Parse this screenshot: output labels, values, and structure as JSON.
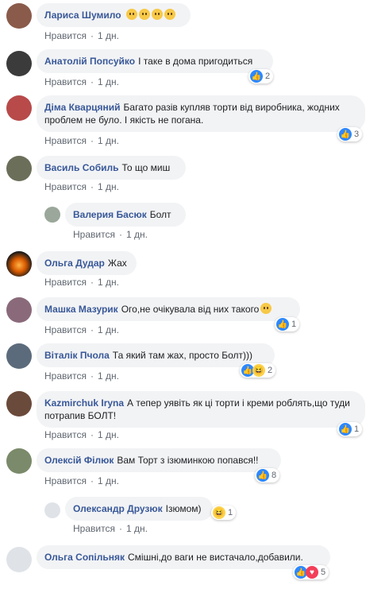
{
  "comments": [
    {
      "name": "Лариса Шумило",
      "text": "",
      "emojis": 4,
      "like": "Нравится",
      "time": "1 дн."
    },
    {
      "name": "Анатолій Попсуйко",
      "text": "І таке в дома пригодиться",
      "like": "Нравится",
      "time": "1 дн.",
      "reactions": "2"
    },
    {
      "name": "Діма Кварцяний",
      "text": "Багато разів купляв торти від виробника, жодних проблем не було. І якість не погана.",
      "like": "Нравится",
      "time": "1 дн.",
      "reactions": "3"
    },
    {
      "name": "Василь Собиль",
      "text": "То що миш",
      "like": "Нравится",
      "time": "1 дн."
    },
    {
      "name": "Валерия Басюк",
      "text": "Болт",
      "like": "Нравится",
      "time": "1 дн."
    },
    {
      "name": "Ольга Дудар",
      "text": "Жах",
      "like": "Нравится",
      "time": "1 дн."
    },
    {
      "name": "Машка Мазурик",
      "text": "Ого,не очікувала від них такого",
      "like": "Нравится",
      "time": "1 дн.",
      "reactions": "1"
    },
    {
      "name": "Віталік Пчола",
      "text": "Та який там жах, просто Болт)))",
      "like": "Нравится",
      "time": "1 дн.",
      "reactions": "2"
    },
    {
      "name": "Kazmirchuk Iryna",
      "text": "А тепер уявіть як ці торти і креми роблять,що туди потрапив БОЛТ!",
      "like": "Нравится",
      "time": "1 дн.",
      "reactions": "1"
    },
    {
      "name": "Олексій Філюк",
      "text": "Вам Торт з ізюминкою попався!!",
      "like": "Нравится",
      "time": "1 дн.",
      "reactions": "8"
    },
    {
      "name": "Олександр Друзюк",
      "text": "Ізюмом)",
      "like": "Нравится",
      "time": "1 дн.",
      "reactions": "1"
    },
    {
      "name": "Ольга Сопільняк",
      "text": "Смішні,до ваги не вистачало,добавили.",
      "like": "Нравится",
      "time": "1 дн.",
      "reactions": "5"
    }
  ],
  "colors": {
    "link": "#385898",
    "bubble": "#f2f3f5",
    "like": "#2d88ff",
    "love": "#f33e58"
  }
}
